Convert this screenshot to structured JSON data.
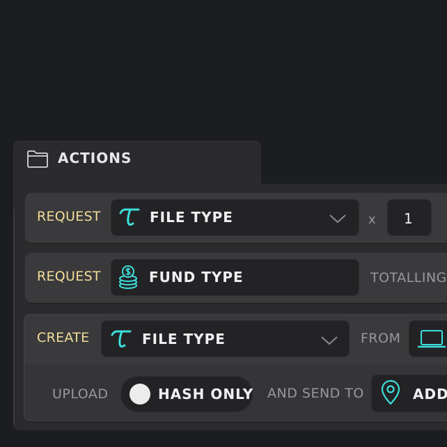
{
  "panel": {
    "title": "ACTIONS",
    "icon": "folder-icon"
  },
  "rows": [
    {
      "verb": "REQUEST",
      "field": {
        "icon": "tau-icon",
        "label": "FILE TYPE",
        "dropdown": true
      },
      "multiplier_label": "x",
      "quantity": "1"
    },
    {
      "verb": "REQUEST",
      "field": {
        "icon": "coins-icon",
        "label": "FUND TYPE"
      },
      "suffix_label": "TOTALLING"
    },
    {
      "verb": "CREATE",
      "field": {
        "icon": "tau-icon",
        "label": "FILE TYPE",
        "dropdown": true
      },
      "from_label": "FROM",
      "from_icon": "laptop-icon",
      "upload_label": "UPLOAD",
      "toggle_label": "HASH ONLY",
      "send_label": "AND SEND TO",
      "destination": {
        "icon": "location-pin-icon",
        "label": "ADDR"
      }
    }
  ],
  "colors": {
    "background": "#1c1d21",
    "panel": "#2b2b2d",
    "row": "#3a3a3c",
    "field": "#232325",
    "verb_label": "#f4dd9a",
    "accent_cyan": "#3de0dc",
    "muted_label": "#98989c",
    "field_text": "#f0f0f2"
  }
}
